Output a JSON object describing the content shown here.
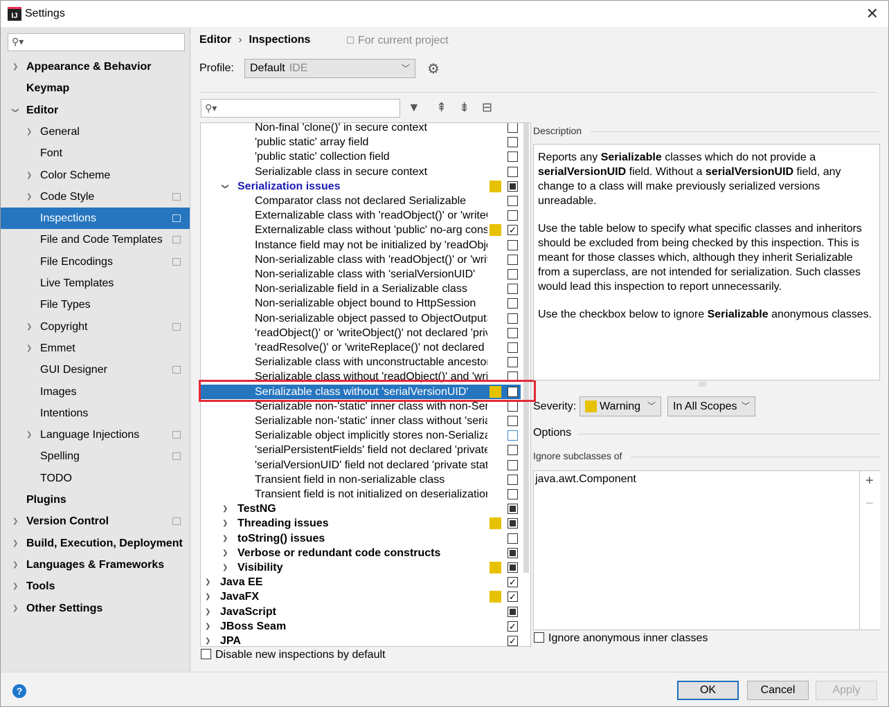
{
  "window": {
    "title": "Settings"
  },
  "sidebar": {
    "items": [
      {
        "label": "Appearance & Behavior",
        "arrow": "›",
        "bold": true,
        "indent": 0
      },
      {
        "label": "Keymap",
        "arrow": "",
        "bold": true,
        "indent": 0
      },
      {
        "label": "Editor",
        "arrow": "⌄",
        "bold": true,
        "indent": 0
      },
      {
        "label": "General",
        "arrow": "›",
        "bold": false,
        "indent": 1
      },
      {
        "label": "Font",
        "arrow": "",
        "bold": false,
        "indent": 1
      },
      {
        "label": "Color Scheme",
        "arrow": "›",
        "bold": false,
        "indent": 1
      },
      {
        "label": "Code Style",
        "arrow": "›",
        "bold": false,
        "indent": 1,
        "project": true
      },
      {
        "label": "Inspections",
        "arrow": "",
        "bold": false,
        "indent": 1,
        "project": true,
        "selected": true
      },
      {
        "label": "File and Code Templates",
        "arrow": "",
        "bold": false,
        "indent": 1,
        "project": true
      },
      {
        "label": "File Encodings",
        "arrow": "",
        "bold": false,
        "indent": 1,
        "project": true
      },
      {
        "label": "Live Templates",
        "arrow": "",
        "bold": false,
        "indent": 1
      },
      {
        "label": "File Types",
        "arrow": "",
        "bold": false,
        "indent": 1
      },
      {
        "label": "Copyright",
        "arrow": "›",
        "bold": false,
        "indent": 1,
        "project": true
      },
      {
        "label": "Emmet",
        "arrow": "›",
        "bold": false,
        "indent": 1
      },
      {
        "label": "GUI Designer",
        "arrow": "",
        "bold": false,
        "indent": 1,
        "project": true
      },
      {
        "label": "Images",
        "arrow": "",
        "bold": false,
        "indent": 1
      },
      {
        "label": "Intentions",
        "arrow": "",
        "bold": false,
        "indent": 1
      },
      {
        "label": "Language Injections",
        "arrow": "›",
        "bold": false,
        "indent": 1,
        "project": true
      },
      {
        "label": "Spelling",
        "arrow": "",
        "bold": false,
        "indent": 1,
        "project": true
      },
      {
        "label": "TODO",
        "arrow": "",
        "bold": false,
        "indent": 1
      },
      {
        "label": "Plugins",
        "arrow": "",
        "bold": true,
        "indent": 0
      },
      {
        "label": "Version Control",
        "arrow": "›",
        "bold": true,
        "indent": 0,
        "project": true
      },
      {
        "label": "Build, Execution, Deployment",
        "arrow": "›",
        "bold": true,
        "indent": 0
      },
      {
        "label": "Languages & Frameworks",
        "arrow": "›",
        "bold": true,
        "indent": 0
      },
      {
        "label": "Tools",
        "arrow": "›",
        "bold": true,
        "indent": 0
      },
      {
        "label": "Other Settings",
        "arrow": "›",
        "bold": true,
        "indent": 0
      }
    ]
  },
  "header": {
    "crumb1": "Editor",
    "sep": "›",
    "crumb2": "Inspections",
    "for_project": "For current project",
    "profile_label": "Profile:",
    "profile_value": "Default",
    "profile_scope": "IDE"
  },
  "inspections": [
    {
      "label": "Non-final 'clone()' in secure context",
      "level": 2,
      "cb": "off"
    },
    {
      "label": "'public static' array field",
      "level": 2,
      "cb": "off"
    },
    {
      "label": "'public static' collection field",
      "level": 2,
      "cb": "off"
    },
    {
      "label": "Serializable class in secure context",
      "level": 2,
      "cb": "off"
    },
    {
      "label": "Serialization issues",
      "level": 1,
      "arrow": "⌄",
      "bold": true,
      "blue": true,
      "sev": true,
      "cb": "mixed"
    },
    {
      "label": "Comparator class not declared Serializable",
      "level": 2,
      "cb": "off"
    },
    {
      "label": "Externalizable class with 'readObject()' or 'writeObject()'",
      "level": 2,
      "cb": "off"
    },
    {
      "label": "Externalizable class without 'public' no-arg constructor",
      "level": 2,
      "sev": true,
      "cb": "on"
    },
    {
      "label": "Instance field may not be initialized by 'readObject()'",
      "level": 2,
      "cb": "off"
    },
    {
      "label": "Non-serializable class with 'readObject()' or 'writeObject()'",
      "level": 2,
      "cb": "off"
    },
    {
      "label": "Non-serializable class with 'serialVersionUID'",
      "level": 2,
      "cb": "off"
    },
    {
      "label": "Non-serializable field in a Serializable class",
      "level": 2,
      "cb": "off"
    },
    {
      "label": "Non-serializable object bound to HttpSession",
      "level": 2,
      "cb": "off"
    },
    {
      "label": "Non-serializable object passed to ObjectOutputStream",
      "level": 2,
      "cb": "off"
    },
    {
      "label": "'readObject()' or 'writeObject()' not declared 'private'",
      "level": 2,
      "cb": "off"
    },
    {
      "label": "'readResolve()' or 'writeReplace()' not declared 'protected'",
      "level": 2,
      "cb": "off"
    },
    {
      "label": "Serializable class with unconstructable ancestor",
      "level": 2,
      "cb": "off"
    },
    {
      "label": "Serializable class without 'readObject()' and 'writeObject()'",
      "level": 2,
      "cb": "off"
    },
    {
      "label": "Serializable class without 'serialVersionUID'",
      "level": 2,
      "sev": true,
      "cb": "on",
      "selected": true
    },
    {
      "label": "Serializable non-'static' inner class with non-Serializable outer class",
      "level": 2,
      "cb": "off"
    },
    {
      "label": "Serializable non-'static' inner class without 'serialVersionUID'",
      "level": 2,
      "cb": "off"
    },
    {
      "label": "Serializable object implicitly stores non-Serializable object",
      "level": 2,
      "cb": "off",
      "hl": true
    },
    {
      "label": "'serialPersistentFields' field not declared 'private static final'",
      "level": 2,
      "cb": "off"
    },
    {
      "label": "'serialVersionUID' field not declared 'private static final long'",
      "level": 2,
      "cb": "off"
    },
    {
      "label": "Transient field in non-serializable class",
      "level": 2,
      "cb": "off"
    },
    {
      "label": "Transient field is not initialized on deserialization",
      "level": 2,
      "cb": "off"
    },
    {
      "label": "TestNG",
      "level": 1,
      "arrow": "›",
      "bold": true,
      "cb": "mixed"
    },
    {
      "label": "Threading issues",
      "level": 1,
      "arrow": "›",
      "bold": true,
      "sev": true,
      "cb": "mixed"
    },
    {
      "label": "toString() issues",
      "level": 1,
      "arrow": "›",
      "bold": true,
      "cb": "off"
    },
    {
      "label": "Verbose or redundant code constructs",
      "level": 1,
      "arrow": "›",
      "bold": true,
      "cb": "mixed"
    },
    {
      "label": "Visibility",
      "level": 1,
      "arrow": "›",
      "bold": true,
      "sev": true,
      "cb": "mixed"
    },
    {
      "label": "Java EE",
      "level": 0,
      "arrow": "›",
      "bold": true,
      "cb": "on"
    },
    {
      "label": "JavaFX",
      "level": 0,
      "arrow": "›",
      "bold": true,
      "sev": true,
      "cb": "on"
    },
    {
      "label": "JavaScript",
      "level": 0,
      "arrow": "›",
      "bold": true,
      "cb": "mixed"
    },
    {
      "label": "JBoss Seam",
      "level": 0,
      "arrow": "›",
      "bold": true,
      "cb": "on"
    },
    {
      "label": "JPA",
      "level": 0,
      "arrow": "›",
      "bold": true,
      "cb": "on"
    }
  ],
  "disable_new_label": "Disable new inspections by default",
  "description": {
    "title": "Description",
    "p1_a": "Reports any ",
    "p1_b": "Serializable",
    "p1_c": " classes which do not provide a ",
    "p1_d": "serialVersionUID",
    "p1_e": " field. Without a ",
    "p1_f": "serialVersionUID",
    "p1_g": " field, any change to a class will make previously serialized versions unreadable.",
    "p2": "Use the table below to specify what specific classes and inheritors should be excluded from being checked by this inspection. This is meant for those classes which, although they inherit Serializable from a superclass, are not intended for serialization. Such classes would lead this inspection to report unnecessarily.",
    "p3_a": "Use the checkbox below to ignore ",
    "p3_b": "Serializable",
    "p3_c": " anonymous classes."
  },
  "severity": {
    "label": "Severity:",
    "value": "Warning",
    "color": "#e6c200",
    "scope": "In All Scopes"
  },
  "options": {
    "title": "Options",
    "ignore_title": "Ignore subclasses of",
    "ignore_items": [
      "java.awt.Component"
    ],
    "ignore_anon_label": "Ignore anonymous inner classes"
  },
  "buttons": {
    "ok": "OK",
    "cancel": "Cancel",
    "apply": "Apply",
    "help": "?"
  },
  "colors": {
    "selection": "#2675bf",
    "warning": "#e6c200",
    "highlight_outline": "#e22b39"
  }
}
